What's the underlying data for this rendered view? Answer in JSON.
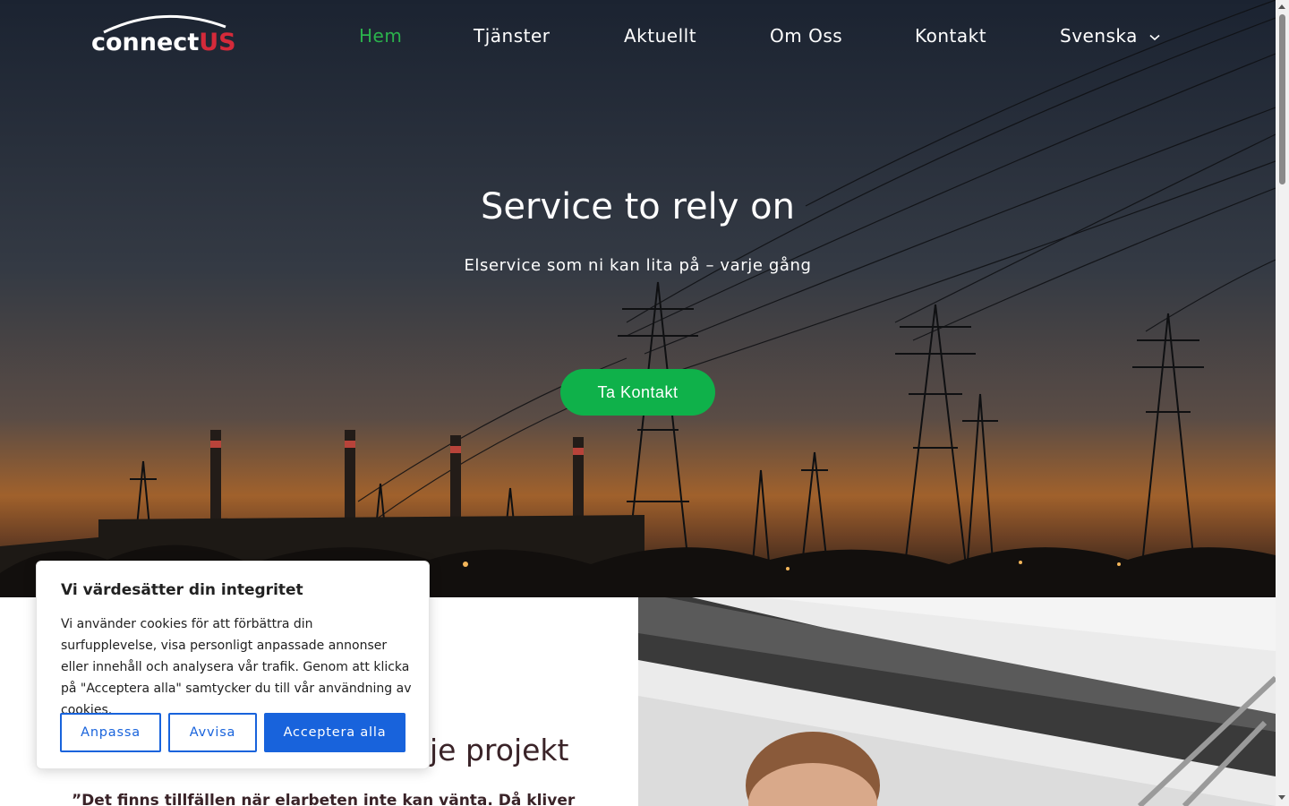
{
  "brand": {
    "logo_main": "connect",
    "logo_accent": "US",
    "accent_color": "#d42a3a"
  },
  "nav": {
    "items": [
      {
        "label": "Hem",
        "active": true
      },
      {
        "label": "Tjänster",
        "active": false
      },
      {
        "label": "Aktuellt",
        "active": false
      },
      {
        "label": "Om Oss",
        "active": false
      },
      {
        "label": "Kontakt",
        "active": false
      },
      {
        "label": "Svenska",
        "active": false,
        "icon": "chevron-down-icon"
      }
    ],
    "active_color": "#2bb24c"
  },
  "hero": {
    "title": "Service to rely on",
    "subtitle": "Elservice som ni kan lita på – varje gång",
    "cta_label": "Ta Kontakt",
    "cta_color": "#0fb14a"
  },
  "section": {
    "heading_visible": "je projekt",
    "quote_visible": "”Det finns tillfällen när elarbeten inte kan vänta. Då kliver"
  },
  "cookie_banner": {
    "title": "Vi värdesätter din integritet",
    "body": "Vi använder cookies för att förbättra din surfupplevelse, visa personligt anpassade annonser eller innehåll och analysera vår trafik. Genom att klicka på \"Acceptera alla\" samtycker du till vår användning av cookies.",
    "customize_label": "Anpassa",
    "reject_label": "Avvisa",
    "accept_label": "Acceptera alla",
    "button_color": "#1863dc"
  }
}
